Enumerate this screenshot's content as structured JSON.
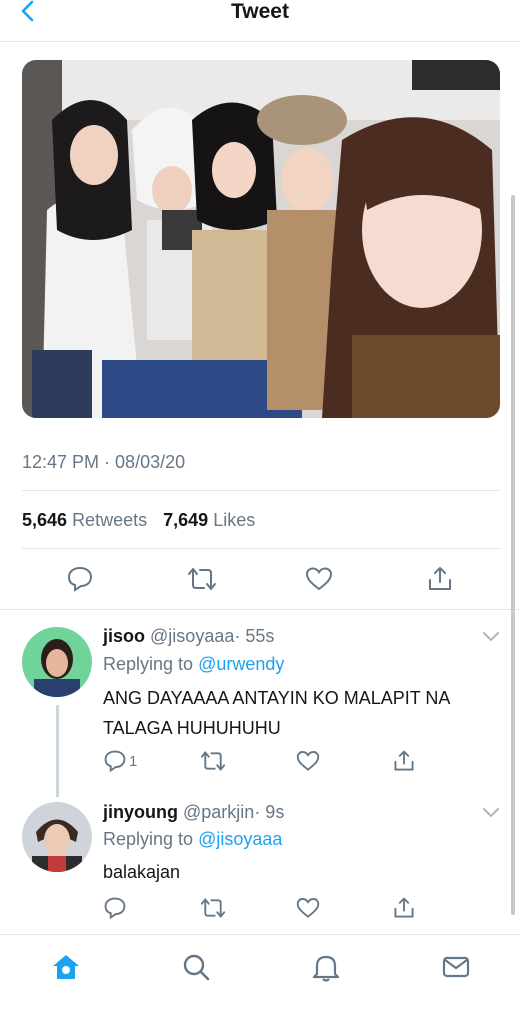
{
  "nav": {
    "title": "Tweet",
    "back_icon": "chevron-left-icon"
  },
  "tweet": {
    "timestamp": "12:47 PM · 08/03/20",
    "retweets_count": "5,646",
    "retweets_label": "Retweets",
    "likes_count": "7,649",
    "likes_label": "Likes"
  },
  "replies": [
    {
      "name": "jisoo",
      "handle": "@jisoyaaa",
      "time": "· 55s",
      "replying_prefix": "Replying to",
      "replying_to": "@urwendy",
      "text": "ANG DAYAAAA ANTAYIN KO MALAPIT NA TALAGA HUHUHUHU",
      "reply_count": "1"
    },
    {
      "name": "jinyoung",
      "handle": "@parkjin",
      "time": "· 9s",
      "replying_prefix": "Replying to",
      "replying_to": "@jisoyaaa",
      "text": "balakajan",
      "reply_count": ""
    }
  ],
  "tabbar": [
    "home-icon",
    "search-icon",
    "notifications-icon",
    "messages-icon"
  ],
  "colors": {
    "accent": "#1da1f2",
    "secondary_text": "#657786",
    "divider": "#e1e8ed"
  }
}
